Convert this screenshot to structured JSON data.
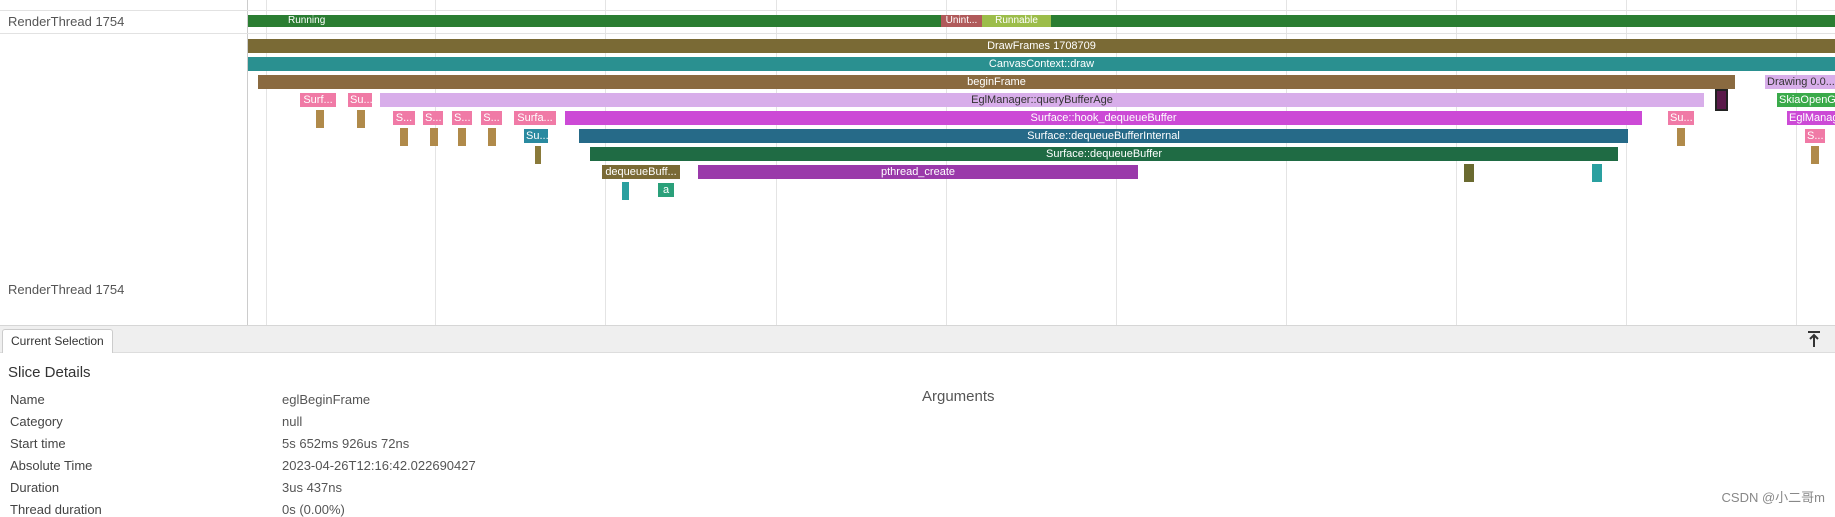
{
  "thread_labels": [
    "RenderThread 1754",
    "RenderThread 1754"
  ],
  "state_bar": {
    "running_label": "Running",
    "uninterruptible_label": "Unint...",
    "runnable_label": "Runnable"
  },
  "slices": {
    "draw_frames": "DrawFrames 1708709",
    "canvas_context_draw": "CanvasContext::draw",
    "begin_frame": "beginFrame",
    "drawing": "Drawing  0.0...",
    "egl_query_buffer_age": "EglManager::queryBufferAge",
    "skia_opengl": "SkiaOpenGL...",
    "surf_a": "Surf...",
    "su_a": "Su...",
    "surface_hook_dequeue": "Surface::hook_dequeueBuffer",
    "su_b": "Su...",
    "egl_manager": "EglManag...",
    "s_1": "S...",
    "s_2": "S...",
    "s_3": "S...",
    "s_4": "S...",
    "surfa": "Surfa...",
    "su_c": "Su...",
    "surface_dequeue_internal": "Surface::dequeueBufferInternal",
    "s_5": "S...",
    "surface_dequeue": "Surface::dequeueBuffer",
    "dequeue_buff": "dequeueBuff...",
    "pthread_create": "pthread_create",
    "a": "a"
  },
  "tabs": {
    "current_selection": "Current Selection"
  },
  "details": {
    "title": "Slice Details",
    "arguments_title": "Arguments",
    "rows": [
      {
        "key": "Name",
        "value": "eglBeginFrame"
      },
      {
        "key": "Category",
        "value": "null"
      },
      {
        "key": "Start time",
        "value": "5s 652ms 926us 72ns"
      },
      {
        "key": "Absolute Time",
        "value": "2023-04-26T12:16:42.022690427"
      },
      {
        "key": "Duration",
        "value": "3us 437ns"
      },
      {
        "key": "Thread duration",
        "value": "0s (0.00%)"
      }
    ]
  },
  "watermark": "CSDN @小二哥m",
  "colors": {
    "running": "#2a7d32",
    "uninterruptible": "#b05a5a",
    "runnable": "#9cbd4a",
    "draw_frames": "#7a6a35",
    "canvas": "#2a9090",
    "begin_frame": "#8a6a40",
    "egl_query": "#d8aeea",
    "hook_dequeue": "#cc4ad6",
    "dequeue_internal": "#266a88",
    "dequeue": "#1f6b44",
    "pthread": "#9a3aaa",
    "pink": "#f07aa6"
  },
  "icons": {
    "pin": "pin-to-top-icon"
  }
}
